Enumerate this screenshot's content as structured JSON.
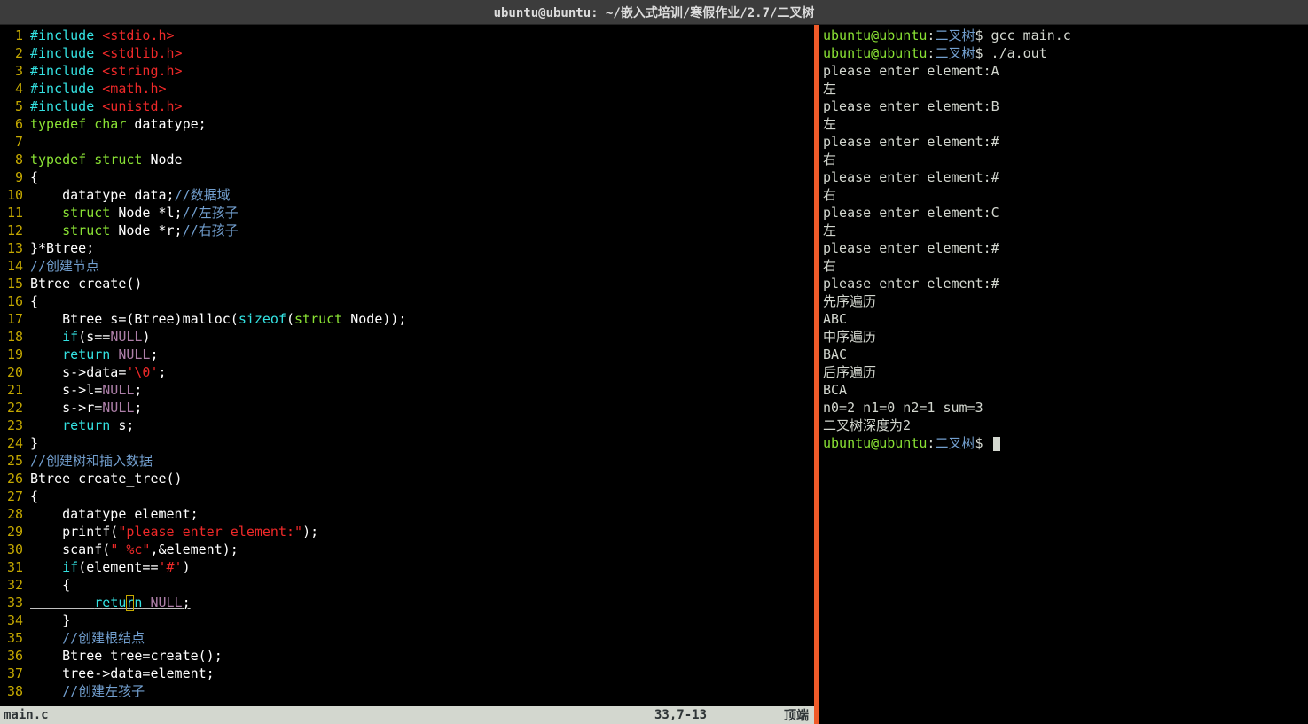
{
  "titlebar": "ubuntu@ubuntu: ~/嵌入式培训/寒假作业/2.7/二叉树",
  "code": [
    [
      [
        "kw",
        "#include "
      ],
      [
        "str",
        "<stdio.h>"
      ]
    ],
    [
      [
        "kw",
        "#include "
      ],
      [
        "str",
        "<stdlib.h>"
      ]
    ],
    [
      [
        "kw",
        "#include "
      ],
      [
        "str",
        "<string.h>"
      ]
    ],
    [
      [
        "kw",
        "#include "
      ],
      [
        "str",
        "<math.h>"
      ]
    ],
    [
      [
        "kw",
        "#include "
      ],
      [
        "str",
        "<unistd.h>"
      ]
    ],
    [
      [
        "type",
        "typedef"
      ],
      [
        "plain",
        " "
      ],
      [
        "type",
        "char"
      ],
      [
        "plain",
        " datatype;"
      ]
    ],
    [
      [
        "plain",
        ""
      ]
    ],
    [
      [
        "type",
        "typedef"
      ],
      [
        "plain",
        " "
      ],
      [
        "type",
        "struct"
      ],
      [
        "plain",
        " Node"
      ]
    ],
    [
      [
        "plain",
        "{"
      ]
    ],
    [
      [
        "plain",
        "    datatype data;"
      ],
      [
        "comment",
        "//数据域"
      ]
    ],
    [
      [
        "plain",
        "    "
      ],
      [
        "type",
        "struct"
      ],
      [
        "plain",
        " Node *l;"
      ],
      [
        "comment",
        "//左孩子"
      ]
    ],
    [
      [
        "plain",
        "    "
      ],
      [
        "type",
        "struct"
      ],
      [
        "plain",
        " Node *r;"
      ],
      [
        "comment",
        "//右孩子"
      ]
    ],
    [
      [
        "plain",
        "}*Btree;"
      ]
    ],
    [
      [
        "comment",
        "//创建节点"
      ]
    ],
    [
      [
        "plain",
        "Btree create()"
      ]
    ],
    [
      [
        "plain",
        "{"
      ]
    ],
    [
      [
        "plain",
        "    Btree s=(Btree)malloc("
      ],
      [
        "kw",
        "sizeof"
      ],
      [
        "plain",
        "("
      ],
      [
        "type",
        "struct"
      ],
      [
        "plain",
        " Node));"
      ]
    ],
    [
      [
        "plain",
        "    "
      ],
      [
        "kw",
        "if"
      ],
      [
        "plain",
        "(s=="
      ],
      [
        "const",
        "NULL"
      ],
      [
        "plain",
        ")"
      ]
    ],
    [
      [
        "plain",
        "    "
      ],
      [
        "kw",
        "return"
      ],
      [
        "plain",
        " "
      ],
      [
        "const",
        "NULL"
      ],
      [
        "plain",
        ";"
      ]
    ],
    [
      [
        "plain",
        "    s->data="
      ],
      [
        "str",
        "'\\0'"
      ],
      [
        "plain",
        ";"
      ]
    ],
    [
      [
        "plain",
        "    s->l="
      ],
      [
        "const",
        "NULL"
      ],
      [
        "plain",
        ";"
      ]
    ],
    [
      [
        "plain",
        "    s->r="
      ],
      [
        "const",
        "NULL"
      ],
      [
        "plain",
        ";"
      ]
    ],
    [
      [
        "plain",
        "    "
      ],
      [
        "kw",
        "return"
      ],
      [
        "plain",
        " s;"
      ]
    ],
    [
      [
        "plain",
        "}"
      ]
    ],
    [
      [
        "comment",
        "//创建树和插入数据"
      ]
    ],
    [
      [
        "plain",
        "Btree create_tree()"
      ]
    ],
    [
      [
        "plain",
        "{"
      ]
    ],
    [
      [
        "plain",
        "    datatype element;"
      ]
    ],
    [
      [
        "plain",
        "    printf("
      ],
      [
        "str",
        "\"please enter element:\""
      ],
      [
        "plain",
        ");"
      ]
    ],
    [
      [
        "plain",
        "    scanf("
      ],
      [
        "str",
        "\" %c\""
      ],
      [
        "plain",
        ",&element);"
      ]
    ],
    [
      [
        "plain",
        "    "
      ],
      [
        "kw",
        "if"
      ],
      [
        "plain",
        "(element=="
      ],
      [
        "str",
        "'#'"
      ],
      [
        "plain",
        ")"
      ]
    ],
    [
      [
        "plain",
        "    {"
      ]
    ],
    [
      [
        "plain",
        "        "
      ],
      [
        "kw",
        "return"
      ],
      [
        "plain",
        " "
      ],
      [
        "const",
        "NULL"
      ],
      [
        "plain",
        ";"
      ]
    ],
    [
      [
        "plain",
        "    }"
      ]
    ],
    [
      [
        "plain",
        "    "
      ],
      [
        "comment",
        "//创建根结点"
      ]
    ],
    [
      [
        "plain",
        "    Btree tree=create();"
      ]
    ],
    [
      [
        "plain",
        "    tree->data=element;"
      ]
    ],
    [
      [
        "plain",
        "    "
      ],
      [
        "comment",
        "//创建左孩子"
      ]
    ]
  ],
  "cursor_line": 33,
  "terminal": [
    {
      "type": "prompt",
      "cmd": "gcc main.c"
    },
    {
      "type": "prompt",
      "cmd": "./a.out"
    },
    {
      "type": "out",
      "text": "please enter element:A"
    },
    {
      "type": "out",
      "text": "左"
    },
    {
      "type": "out",
      "text": "please enter element:B"
    },
    {
      "type": "out",
      "text": "左"
    },
    {
      "type": "out",
      "text": "please enter element:#"
    },
    {
      "type": "out",
      "text": "右"
    },
    {
      "type": "out",
      "text": "please enter element:#"
    },
    {
      "type": "out",
      "text": "右"
    },
    {
      "type": "out",
      "text": "please enter element:C"
    },
    {
      "type": "out",
      "text": "左"
    },
    {
      "type": "out",
      "text": "please enter element:#"
    },
    {
      "type": "out",
      "text": "右"
    },
    {
      "type": "out",
      "text": "please enter element:#"
    },
    {
      "type": "out",
      "text": "先序遍历"
    },
    {
      "type": "out",
      "text": "ABC"
    },
    {
      "type": "out",
      "text": "中序遍历"
    },
    {
      "type": "out",
      "text": "BAC"
    },
    {
      "type": "out",
      "text": "后序遍历"
    },
    {
      "type": "out",
      "text": "BCA"
    },
    {
      "type": "out",
      "text": "n0=2 n1=0 n2=1 sum=3"
    },
    {
      "type": "out",
      "text": "二叉树深度为2"
    },
    {
      "type": "prompt",
      "cmd": "",
      "cursor": true
    }
  ],
  "prompt": {
    "user": "ubuntu@ubuntu",
    "path": "二叉树"
  },
  "status": {
    "file": "main.c",
    "pos": "33,7-13",
    "right": "顶端"
  }
}
